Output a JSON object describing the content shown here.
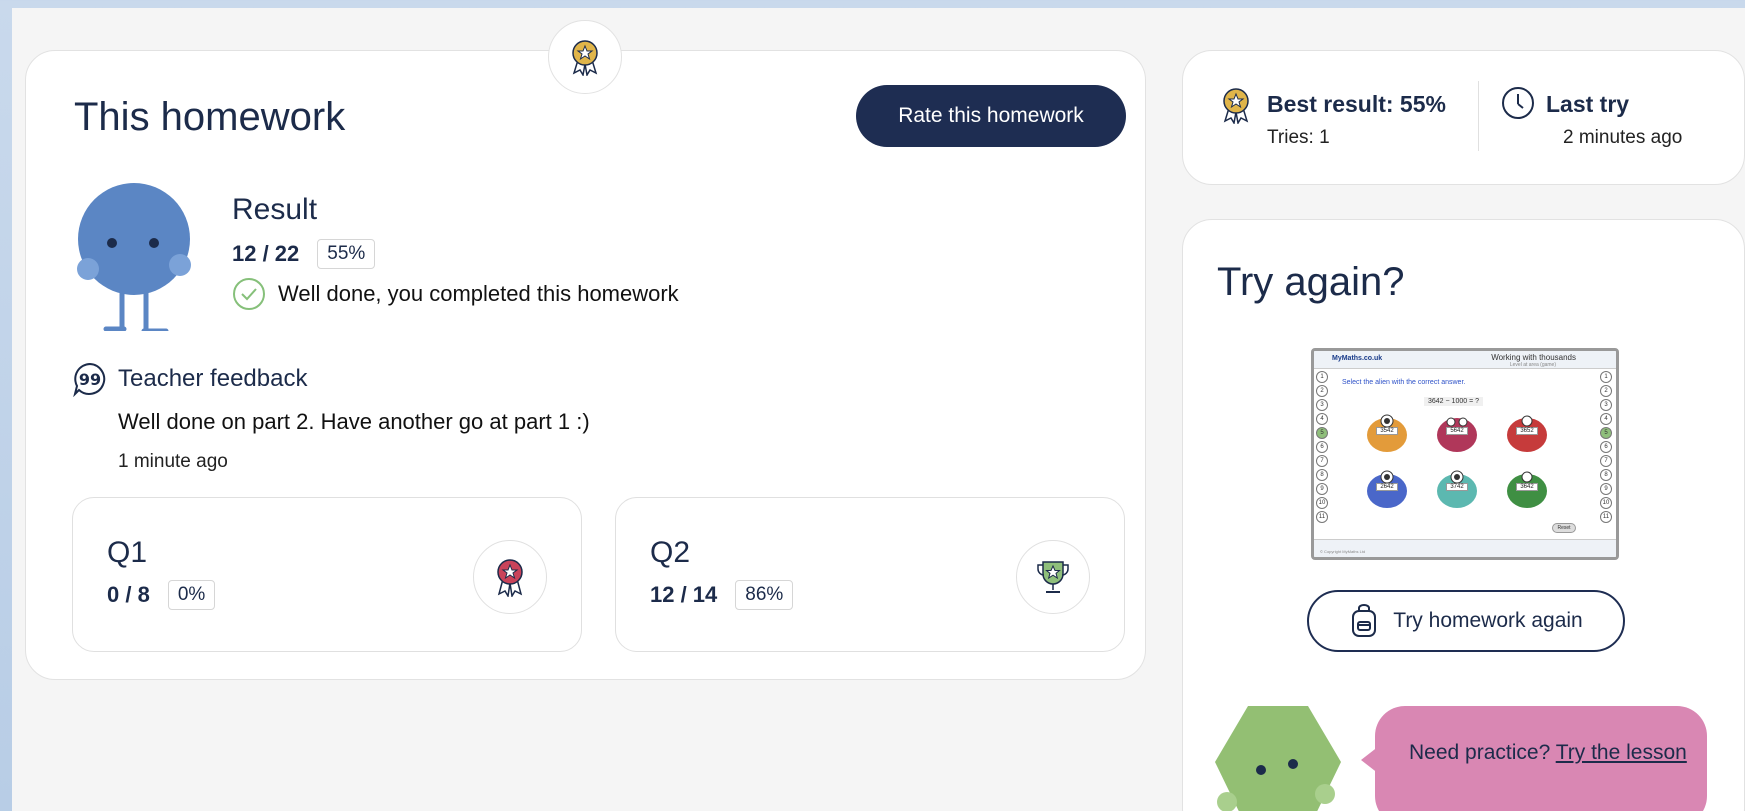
{
  "main": {
    "title": "This homework",
    "rate_button": "Rate this homework",
    "result": {
      "heading": "Result",
      "score": "12 / 22",
      "percent": "55%",
      "completed_message": "Well done, you completed this homework"
    },
    "feedback": {
      "heading": "Teacher feedback",
      "text": "Well done on part 2. Have another go at part 1 :)",
      "time": "1 minute ago"
    },
    "questions": [
      {
        "label": "Q1",
        "score": "0 / 8",
        "percent": "0%",
        "icon": "rosette-award-icon"
      },
      {
        "label": "Q2",
        "score": "12 / 14",
        "percent": "86%",
        "icon": "trophy-icon"
      }
    ]
  },
  "stats": {
    "best_result": "Best result: 55%",
    "tries": "Tries: 1",
    "last_try_label": "Last try",
    "last_try_time": "2 minutes ago"
  },
  "try_again": {
    "title": "Try again?",
    "button": "Try homework again",
    "preview": {
      "logo": "MyMaths.co.uk",
      "title": "Working with thousands",
      "subtitle": "Level at area (game)",
      "instruction": "Select the alien with the correct answer.",
      "question": "3642 − 1000 = ?",
      "aliens": [
        "3542",
        "5642",
        "3652",
        "2642",
        "3742",
        "3642"
      ],
      "reset": "Reset",
      "footer": "© Copyright MyMaths Ltd"
    },
    "bubble_text": "Need practice? ",
    "bubble_link": "Try the lesson"
  },
  "colors": {
    "navy": "#1e2d52",
    "mascot_blue": "#5b86c4",
    "mascot_green": "#93bf73",
    "bubble_pink": "#d987b3",
    "check_green": "#86c07a",
    "badge_gold": "#e0b54a"
  }
}
